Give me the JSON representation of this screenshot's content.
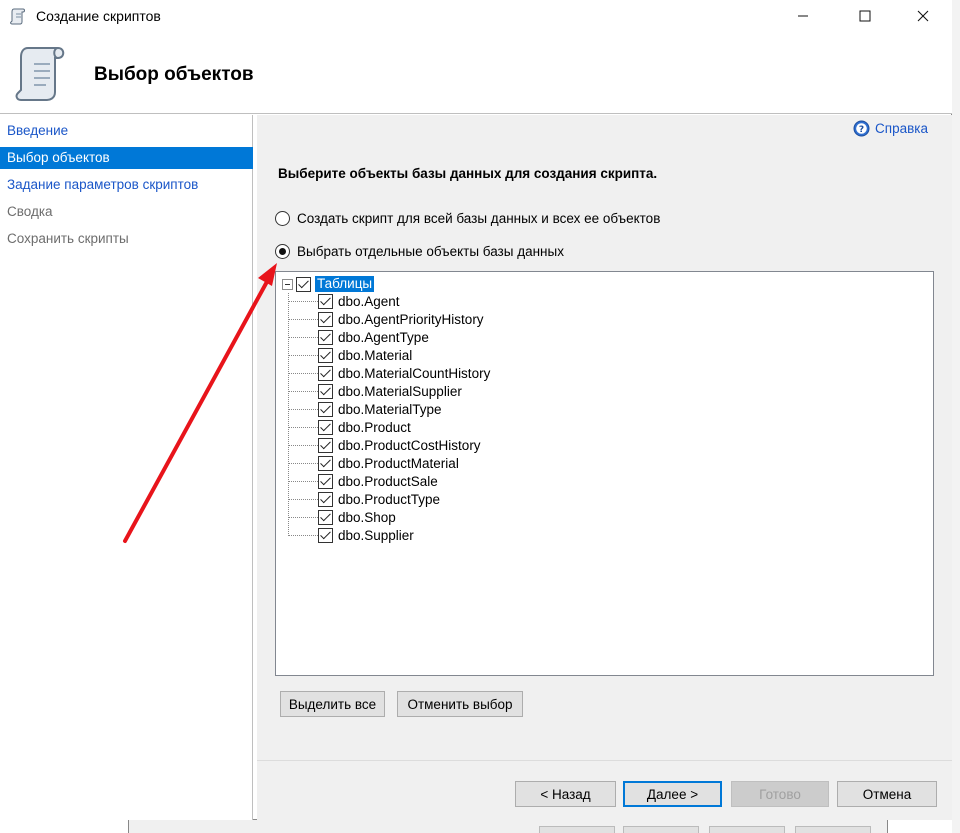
{
  "window": {
    "title": "Создание скриптов",
    "header_title": "Выбор объектов",
    "controls": {
      "minimize": "—",
      "maximize": "☐",
      "close": "✕"
    }
  },
  "nav": {
    "items": [
      {
        "label": "Введение",
        "state": "link"
      },
      {
        "label": "Выбор объектов",
        "state": "selected"
      },
      {
        "label": "Задание параметров скриптов",
        "state": "link"
      },
      {
        "label": "Сводка",
        "state": "disabled"
      },
      {
        "label": "Сохранить скрипты",
        "state": "disabled"
      }
    ]
  },
  "content": {
    "help_label": "Справка",
    "section_title": "Выберите объекты базы данных для создания скрипта.",
    "radio_all": "Создать скрипт для всей базы данных и всех ее объектов",
    "radio_select": "Выбрать отдельные объекты базы данных",
    "tree": {
      "root_label": "Таблицы",
      "items": [
        "dbo.Agent",
        "dbo.AgentPriorityHistory",
        "dbo.AgentType",
        "dbo.Material",
        "dbo.MaterialCountHistory",
        "dbo.MaterialSupplier",
        "dbo.MaterialType",
        "dbo.Product",
        "dbo.ProductCostHistory",
        "dbo.ProductMaterial",
        "dbo.ProductSale",
        "dbo.ProductType",
        "dbo.Shop",
        "dbo.Supplier"
      ]
    },
    "select_all_label": "Выделить все",
    "deselect_label": "Отменить выбор"
  },
  "footer": {
    "back_label": "< Назад",
    "next_label": "Далее >",
    "finish_label": "Готово",
    "cancel_label": "Отмена"
  },
  "colors": {
    "accent": "#0078d7",
    "link": "#1a56c8",
    "annotation_arrow": "#e8141b"
  }
}
